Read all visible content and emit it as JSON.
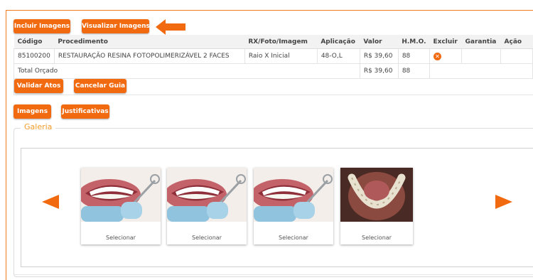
{
  "top_buttons": {
    "incluir": "Incluir Imagens",
    "visualizar": "Visualizar Imagens"
  },
  "table": {
    "headers": [
      "Código",
      "Procedimento",
      "RX/Foto/Imagem",
      "Aplicação",
      "Valor",
      "H.M.O.",
      "Excluir",
      "Garantia",
      "Ação"
    ],
    "rows": [
      {
        "codigo": "85100200",
        "procedimento": "RESTAURAÇÃO RESINA FOTOPOLIMERIZÁVEL 2 FACES",
        "rx": "Raio X Inicial",
        "aplicacao": "48-O,L",
        "valor": "R$ 39,60",
        "hmo": "88",
        "excluir_icon": "close-circle-icon"
      }
    ],
    "total": {
      "label": "Total Orçado",
      "valor": "R$ 39,60",
      "hmo": "88"
    }
  },
  "action_buttons": {
    "validar": "Validar Atos",
    "cancelar": "Cancelar Guia"
  },
  "tab_buttons": {
    "imagens": "Imagens",
    "justificativas": "Justificativas"
  },
  "galeria": {
    "legend": "Galeria",
    "items": [
      {
        "label": "Selecionar",
        "image": "smile-dental-photo"
      },
      {
        "label": "Selecionar",
        "image": "smile-dental-photo"
      },
      {
        "label": "Selecionar",
        "image": "smile-dental-photo"
      },
      {
        "label": "Selecionar",
        "image": "lower-arch-occlusal-photo"
      }
    ]
  },
  "colors": {
    "accent": "#f26a10",
    "legend": "#f39c2b"
  }
}
